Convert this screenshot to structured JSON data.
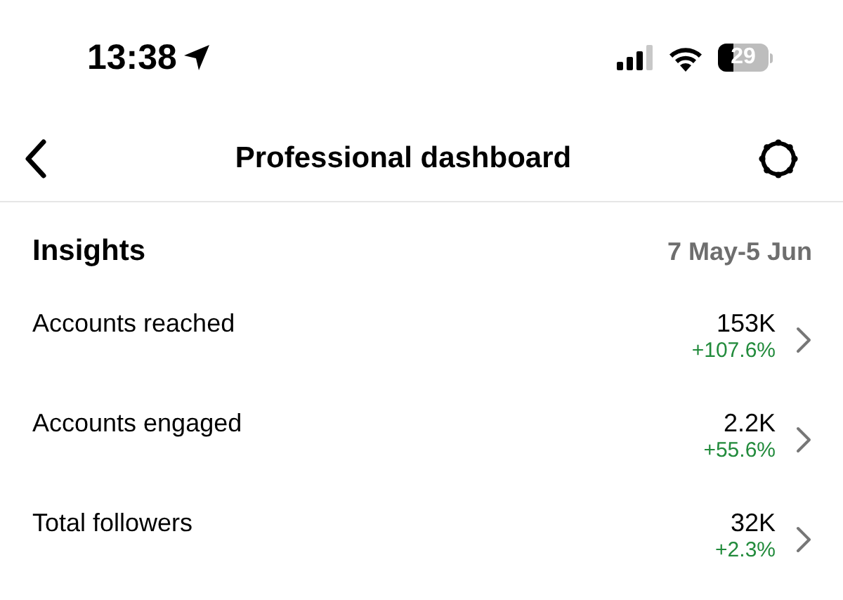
{
  "status_bar": {
    "time": "13:38",
    "battery": "29"
  },
  "nav": {
    "title": "Professional dashboard"
  },
  "insights": {
    "title": "Insights",
    "date_range": "7 May-5 Jun",
    "rows": [
      {
        "label": "Accounts reached",
        "value": "153K",
        "change": "+107.6%",
        "color": "#228b3c"
      },
      {
        "label": "Accounts engaged",
        "value": "2.2K",
        "change": "+55.6%",
        "color": "#228b3c"
      },
      {
        "label": "Total followers",
        "value": "32K",
        "change": "+2.3%",
        "color": "#228b3c"
      }
    ]
  }
}
